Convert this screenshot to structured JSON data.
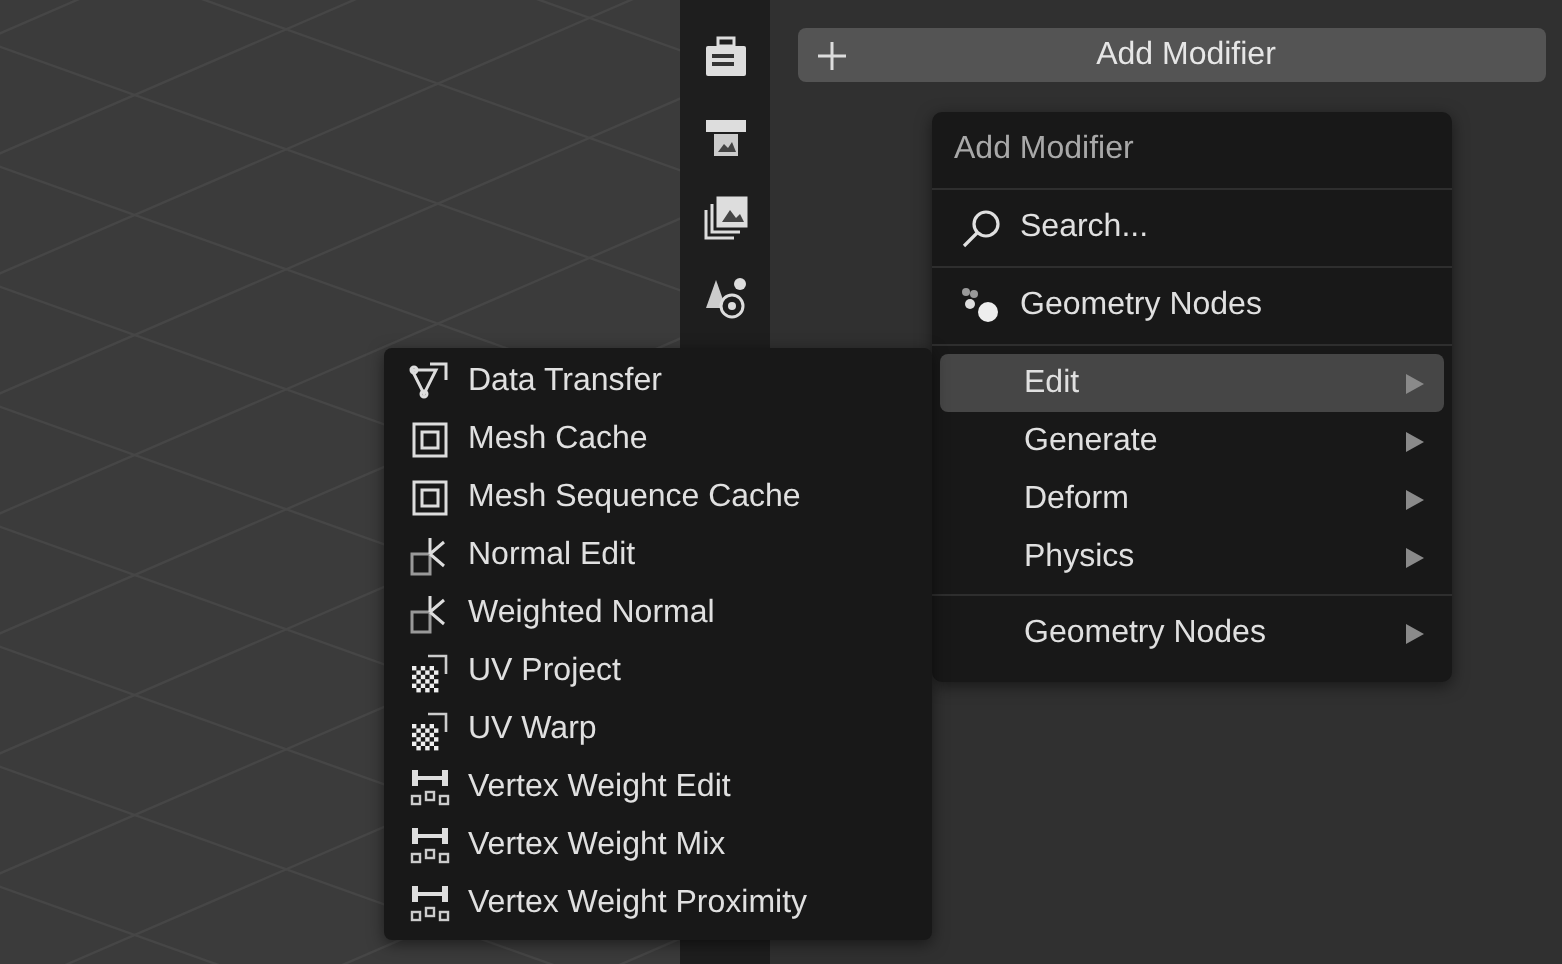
{
  "add_button": {
    "label": "Add Modifier"
  },
  "menu": {
    "title": "Add Modifier",
    "sections": [
      [
        {
          "kind": "search",
          "label": "Search..."
        }
      ],
      [
        {
          "kind": "nodes",
          "label": "Geometry Nodes"
        }
      ],
      [
        {
          "kind": "submenu",
          "label": "Edit",
          "selected": true
        },
        {
          "kind": "submenu",
          "label": "Generate",
          "selected": false
        },
        {
          "kind": "submenu",
          "label": "Deform",
          "selected": false
        },
        {
          "kind": "submenu",
          "label": "Physics",
          "selected": false
        }
      ],
      [
        {
          "kind": "submenu",
          "label": "Geometry Nodes",
          "selected": false
        }
      ]
    ]
  },
  "submenu": {
    "items": [
      {
        "kind": "data-transfer",
        "label": "Data Transfer"
      },
      {
        "kind": "mesh-cache",
        "label": "Mesh Cache"
      },
      {
        "kind": "mesh-cache",
        "label": "Mesh Sequence Cache"
      },
      {
        "kind": "normal",
        "label": "Normal Edit"
      },
      {
        "kind": "normal",
        "label": "Weighted Normal"
      },
      {
        "kind": "uv",
        "label": "UV Project"
      },
      {
        "kind": "uv",
        "label": "UV Warp"
      },
      {
        "kind": "vertex-weight",
        "label": "Vertex Weight Edit"
      },
      {
        "kind": "vertex-weight",
        "label": "Vertex Weight Mix"
      },
      {
        "kind": "vertex-weight",
        "label": "Vertex Weight Proximity"
      }
    ]
  }
}
